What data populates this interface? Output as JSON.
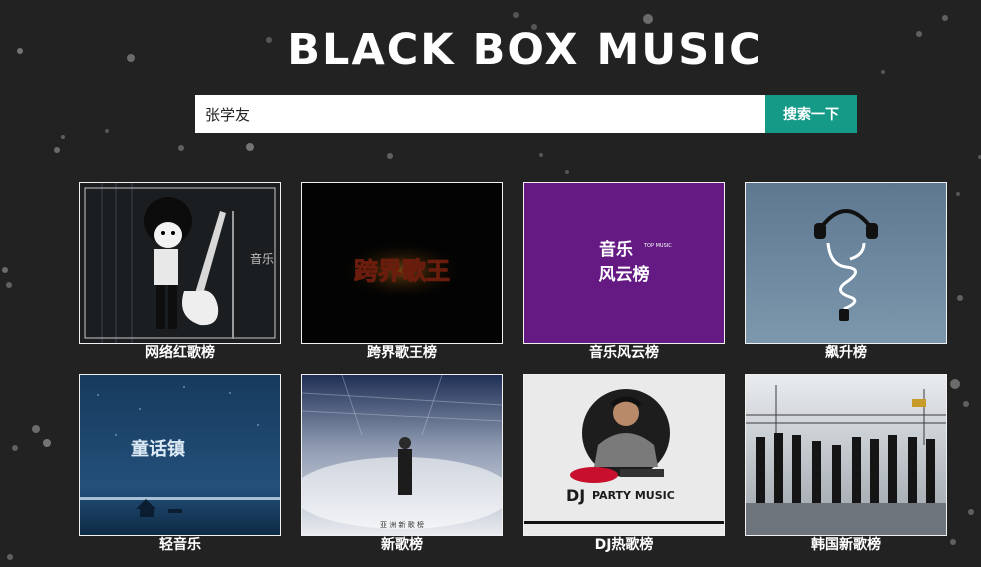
{
  "header": {
    "title": "BLACK BOX MUSIC"
  },
  "search": {
    "value": "张学友",
    "button_label": "搜索一下"
  },
  "playlists": [
    {
      "label": "网络红歌榜",
      "icon": "cartoon-guitar-icon"
    },
    {
      "label": "跨界歌王榜",
      "icon": "show-logo-icon"
    },
    {
      "label": "音乐风云榜",
      "icon": "music-chart-logo-icon"
    },
    {
      "label": "飙升榜",
      "icon": "headphones-icon"
    },
    {
      "label": "轻音乐",
      "icon": "night-lake-icon"
    },
    {
      "label": "新歌榜",
      "icon": "singer-mist-icon"
    },
    {
      "label": "DJ热歌榜",
      "icon": "dj-turntable-icon"
    },
    {
      "label": "韩国新歌榜",
      "icon": "girl-group-icon"
    }
  ],
  "thumb_text": {
    "show_logo": "跨界歌王",
    "chart_logo_top": "音乐",
    "chart_logo_bottom": "风云榜",
    "chart_logo_tag": "TOP MUSIC",
    "lake_text": "童话镇",
    "singer_caption": "亚 洲 新 歌 榜",
    "dj_text": "DJ",
    "dj_party": "PARTY MUSIC",
    "cartoon_side_text": "音乐"
  },
  "colors": {
    "background": "#222222",
    "accent": "#159a87",
    "chart_purple": "#641a82"
  }
}
